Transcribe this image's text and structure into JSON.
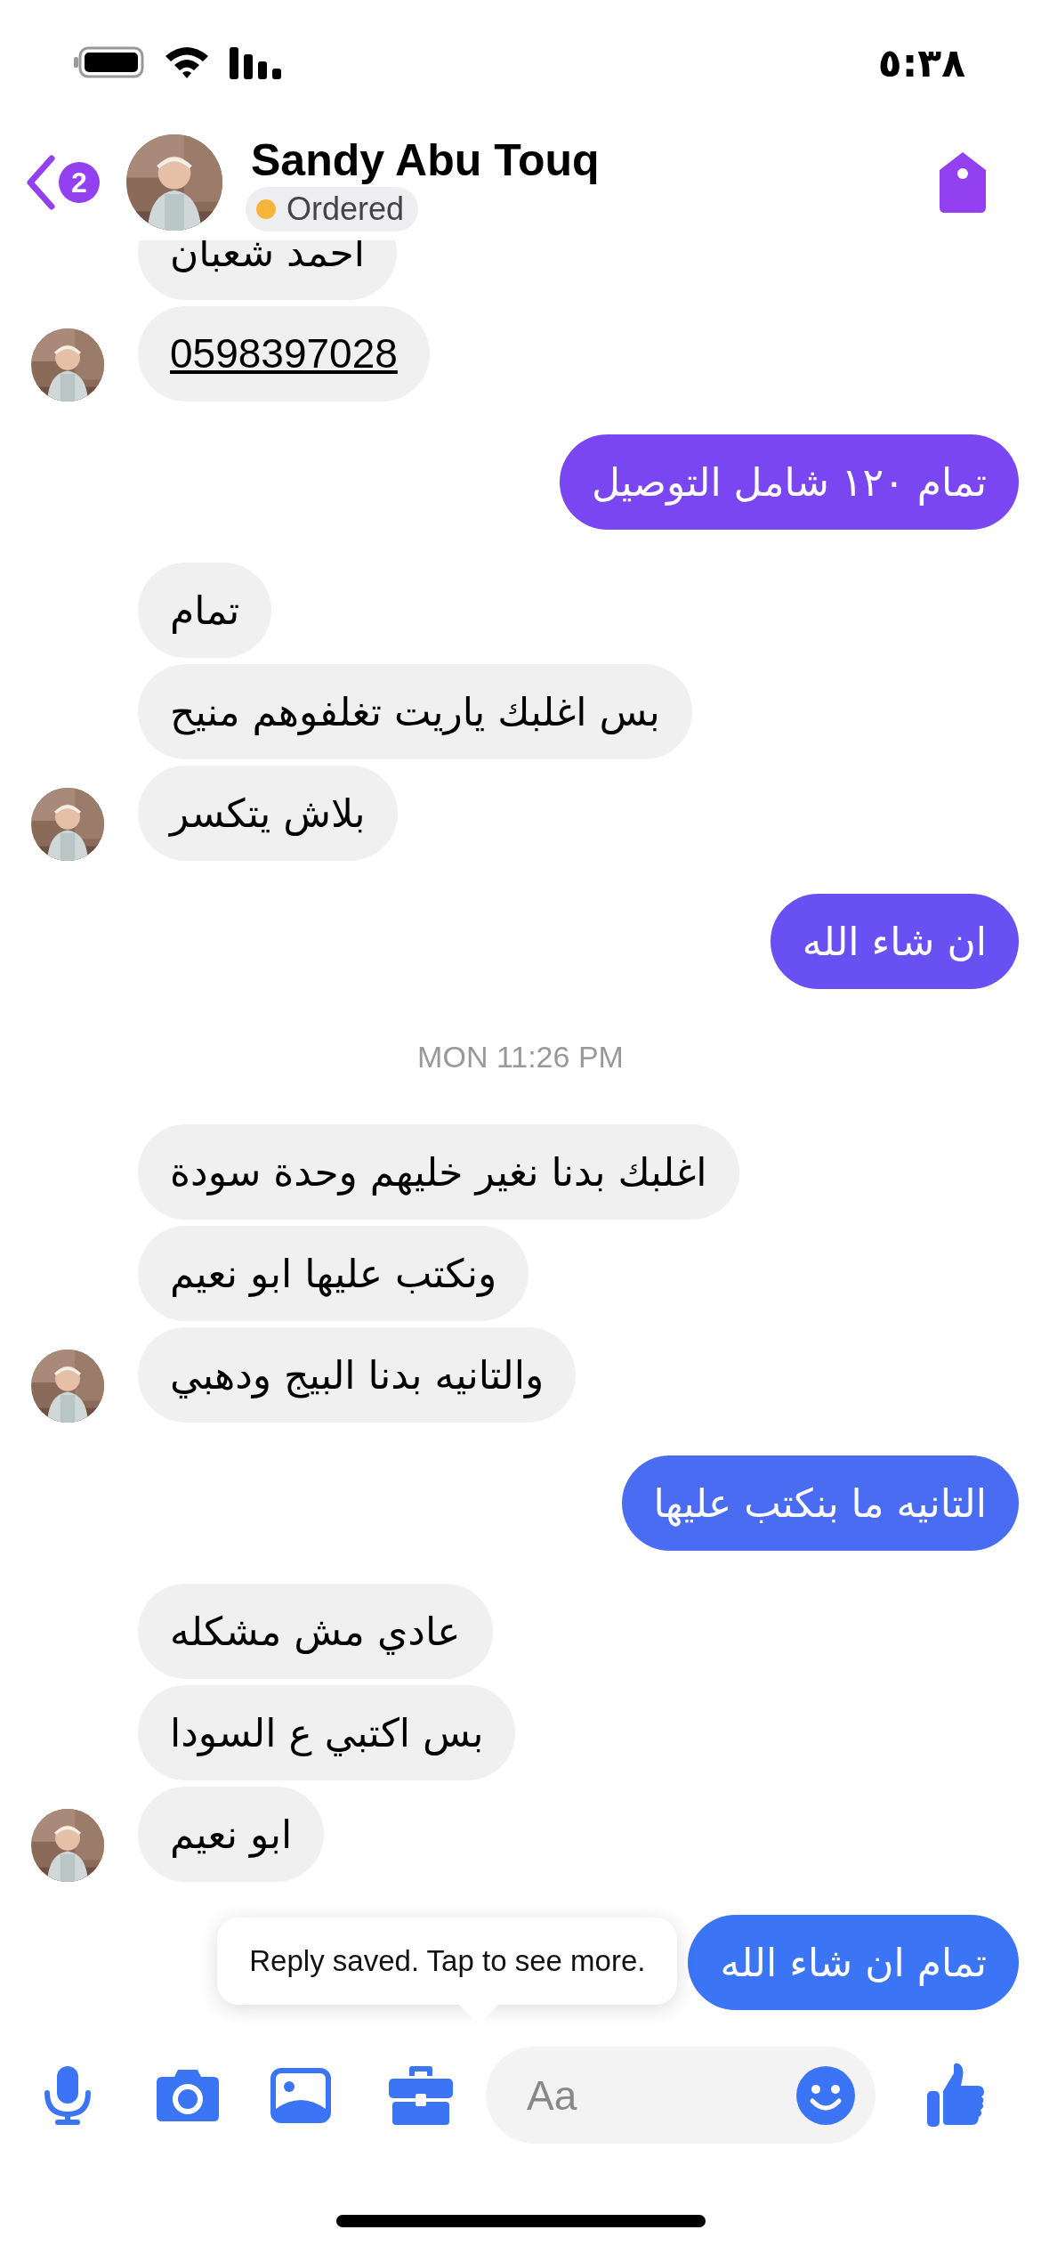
{
  "status_bar": {
    "time": "٥:٣٨"
  },
  "header": {
    "unread_count": "2",
    "name": "Sandy Abu Touq",
    "label": {
      "text": "Ordered",
      "color": "#f5b53b"
    }
  },
  "conversation": [
    {
      "kind": "received",
      "messages": [
        {
          "text": "احمد شعبان",
          "link": false
        },
        {
          "text": "0598397028",
          "link": true
        }
      ]
    },
    {
      "kind": "sent",
      "text": "تمام ١٢٠ شامل التوصيل",
      "color": "#7a46f1"
    },
    {
      "kind": "received",
      "messages": [
        {
          "text": "تمام",
          "link": false
        },
        {
          "text": "بس اغلبك ياريت تغلفوهم منيح",
          "link": false
        },
        {
          "text": "بلاش يتكسر",
          "link": false
        }
      ]
    },
    {
      "kind": "sent",
      "text": "ان شاء الله",
      "color": "#6950f2"
    },
    {
      "kind": "timestamp",
      "text": "MON 11:26 PM"
    },
    {
      "kind": "received",
      "messages": [
        {
          "text": "اغلبك بدنا نغير خليهم وحدة سودة",
          "link": false
        },
        {
          "text": "ونكتب عليها ابو نعيم",
          "link": false
        },
        {
          "text": "والتانيه بدنا البيج ودهبي",
          "link": false
        }
      ]
    },
    {
      "kind": "sent",
      "text": "التانيه ما بنكتب عليها",
      "color": "#4a6cf3"
    },
    {
      "kind": "received",
      "messages": [
        {
          "text": "عادي مش مشكله",
          "link": false
        },
        {
          "text": "بس اكتبي ع السودا",
          "link": false
        },
        {
          "text": "ابو نعيم",
          "link": false
        }
      ]
    },
    {
      "kind": "sent",
      "text": "تمام ان شاء الله",
      "color": "#3b74f5",
      "tooltip": "Reply saved. Tap to see more."
    }
  ],
  "composer": {
    "placeholder": "Aa"
  }
}
